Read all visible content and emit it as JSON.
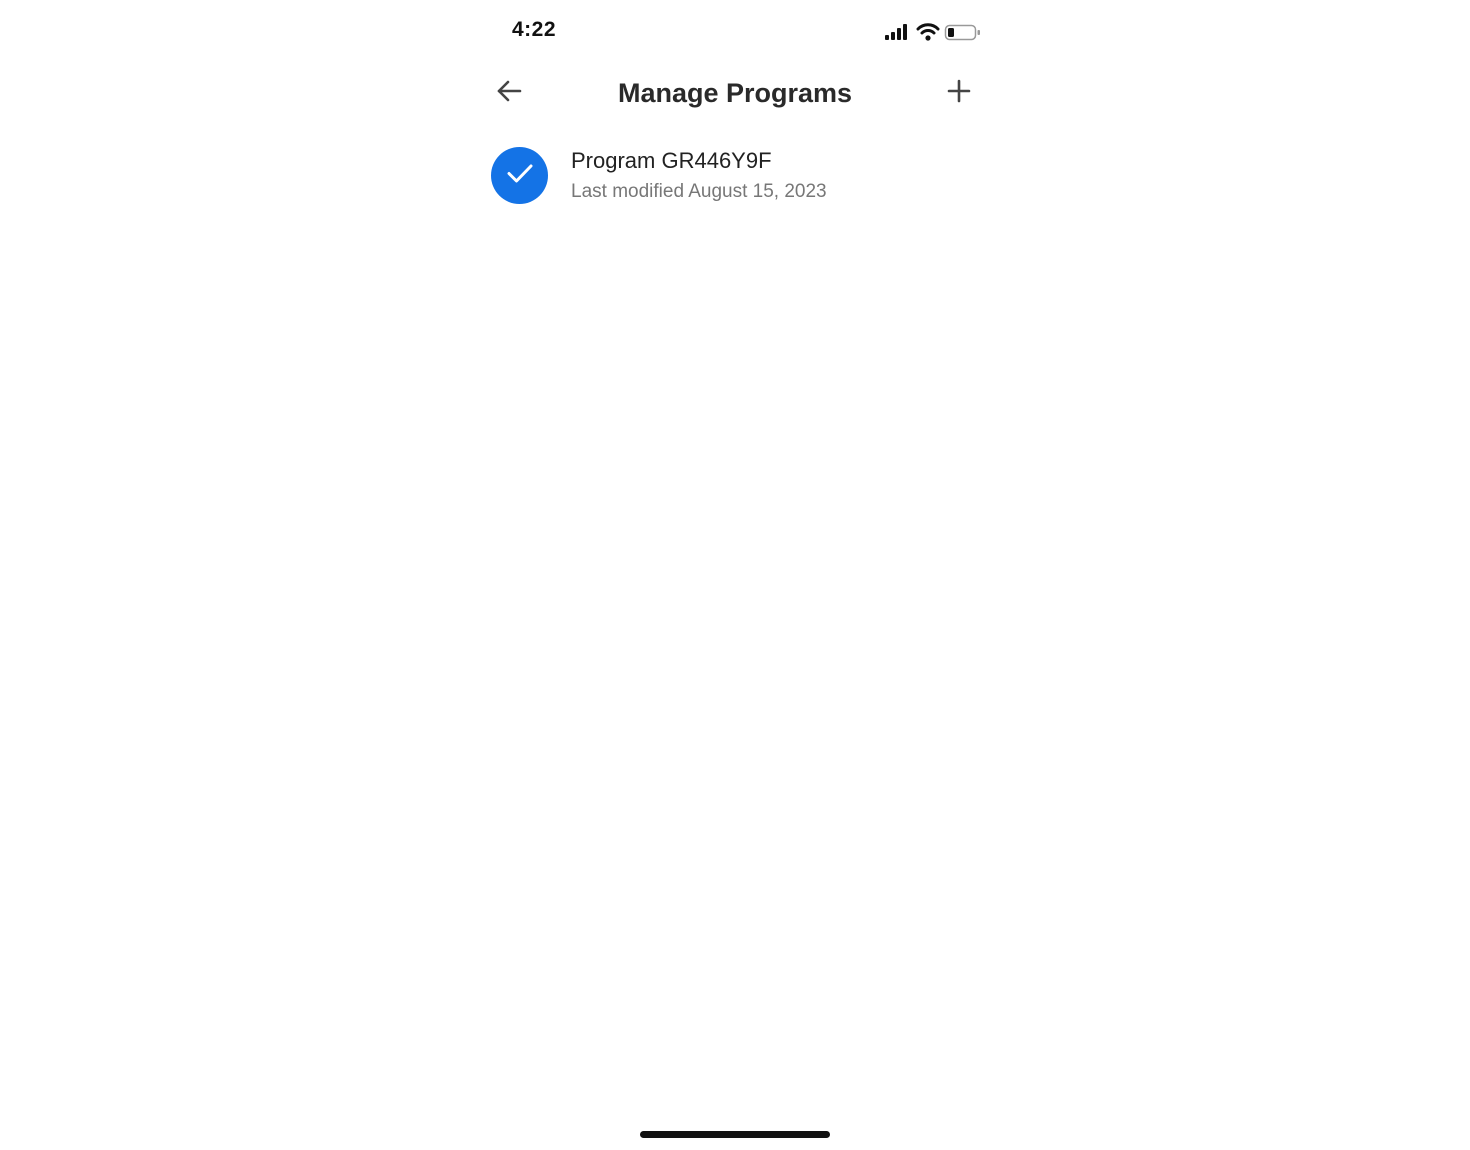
{
  "status_bar": {
    "time": "4:22",
    "icons": [
      "signal-icon",
      "wifi-icon",
      "battery-icon"
    ]
  },
  "header": {
    "title": "Manage Programs",
    "back_icon": "arrow-left-icon",
    "add_icon": "plus-icon"
  },
  "programs": [
    {
      "name": "Program GR446Y9F",
      "modified": "Last modified August 15, 2023",
      "selected": true
    }
  ],
  "colors": {
    "accent": "#1473e6",
    "title_text": "#2a2a2a",
    "secondary_text": "#777777",
    "background": "#ffffff"
  }
}
